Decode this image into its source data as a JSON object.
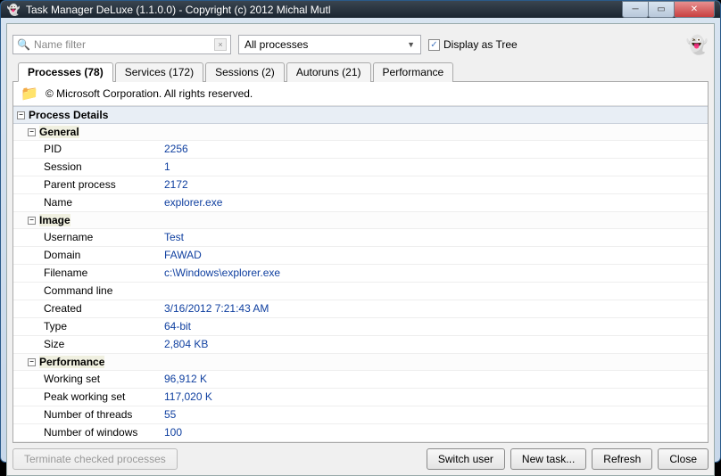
{
  "window": {
    "title": "Task Manager DeLuxe (1.1.0.0) - Copyright (c) 2012 Michal Mutl"
  },
  "toolbar": {
    "filter_placeholder": "Name filter",
    "dropdown_selected": "All processes",
    "tree_checkbox_label": "Display as Tree",
    "tree_checked": "✓"
  },
  "tabs": [
    {
      "label": "Processes (78)",
      "active": true
    },
    {
      "label": "Services (172)",
      "active": false
    },
    {
      "label": "Sessions (2)",
      "active": false
    },
    {
      "label": "Autoruns (21)",
      "active": false
    },
    {
      "label": "Performance",
      "active": false
    }
  ],
  "process_meta": {
    "copyright": "© Microsoft Corporation. All rights reserved."
  },
  "details": {
    "title": "Process Details",
    "groups": [
      {
        "name": "General",
        "rows": [
          {
            "key": "PID",
            "val": "2256"
          },
          {
            "key": "Session",
            "val": "1"
          },
          {
            "key": "Parent process",
            "val": "2172"
          },
          {
            "key": "Name",
            "val": "explorer.exe"
          }
        ]
      },
      {
        "name": "Image",
        "rows": [
          {
            "key": "Username",
            "val": "Test"
          },
          {
            "key": "Domain",
            "val": "FAWAD"
          },
          {
            "key": "Filename",
            "val": "c:\\Windows\\explorer.exe"
          },
          {
            "key": "Command line",
            "val": ""
          },
          {
            "key": "Created",
            "val": "3/16/2012 7:21:43 AM"
          },
          {
            "key": "Type",
            "val": "64-bit"
          },
          {
            "key": "Size",
            "val": "2,804 KB"
          }
        ]
      },
      {
        "name": "Performance",
        "rows": [
          {
            "key": "Working set",
            "val": "96,912 K"
          },
          {
            "key": "Peak working set",
            "val": "117,020 K"
          },
          {
            "key": "Number of threads",
            "val": "55"
          },
          {
            "key": "Number of windows",
            "val": "100"
          }
        ]
      }
    ]
  },
  "buttons": {
    "terminate": "Terminate checked processes",
    "switch_user": "Switch user",
    "new_task": "New task...",
    "refresh": "Refresh",
    "close": "Close"
  }
}
